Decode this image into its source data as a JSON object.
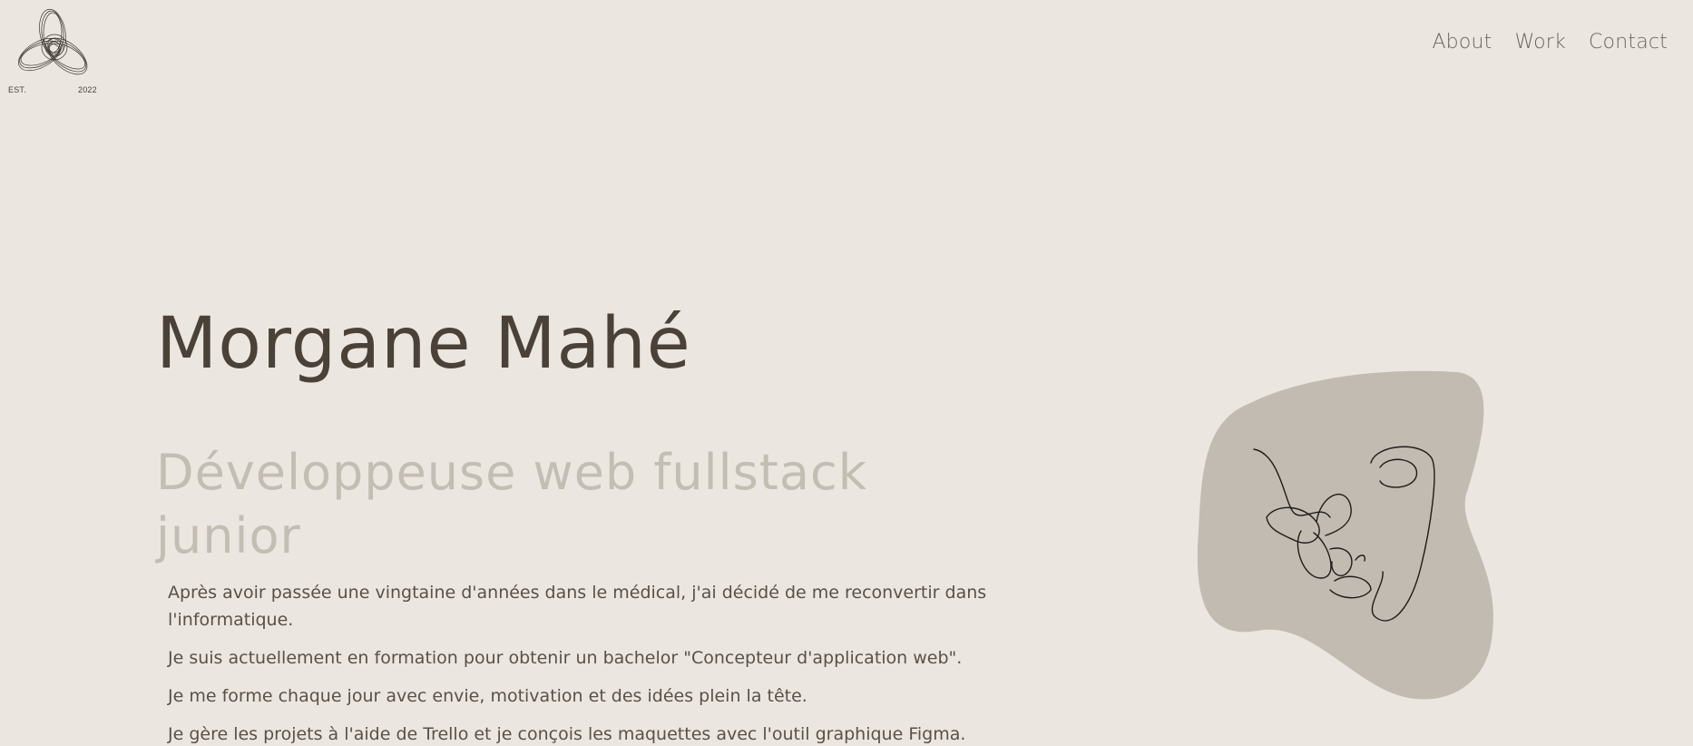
{
  "logo": {
    "est_label": "EST.",
    "year": "2022",
    "icon": "spiral-knot-logo-icon"
  },
  "nav": {
    "items": [
      {
        "label": "About"
      },
      {
        "label": "Work"
      },
      {
        "label": "Contact"
      }
    ]
  },
  "hero": {
    "name": "Morgane Mahé",
    "subtitle": "Développeuse web fullstack junior"
  },
  "bio": {
    "paragraphs": [
      "Après avoir passée une vingtaine d'années dans le médical, j'ai décidé de me reconvertir dans l'informatique.",
      "Je suis actuellement en formation pour obtenir un bachelor \"Concepteur d'application web\".",
      "Je me forme chaque jour avec envie, motivation et des idées plein la tête.",
      "Je gère les projets à l'aide de Trello et je conçois les maquettes avec l'outil graphique Figma."
    ]
  },
  "portrait": {
    "icon": "line-art-face-butterfly-illustration",
    "blob_color": "#c1bbb1"
  },
  "colors": {
    "background": "#ebe7e0",
    "text_dark": "#4a4139",
    "text_muted": "#c3bdb4",
    "nav_text": "#6e655d"
  }
}
